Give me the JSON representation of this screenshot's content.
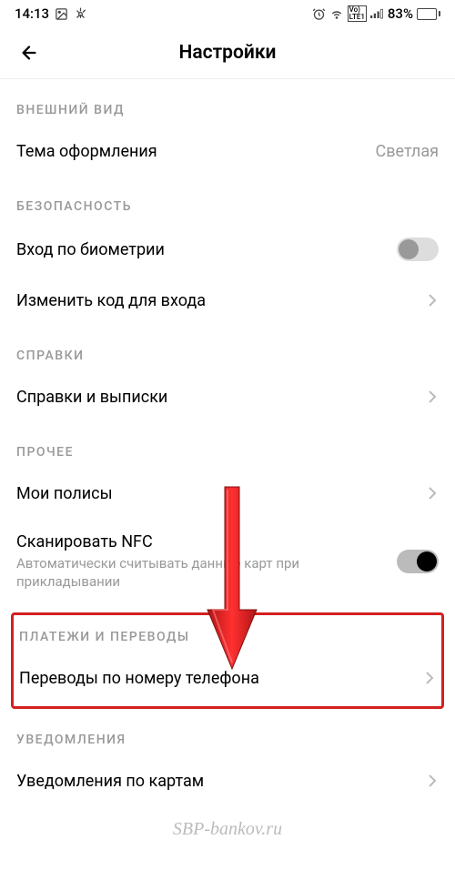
{
  "statusBar": {
    "time": "14:13",
    "battery": "83%"
  },
  "header": {
    "title": "Настройки"
  },
  "sections": {
    "appearance": {
      "header": "ВНЕШНИЙ ВИД",
      "theme": {
        "label": "Тема оформления",
        "value": "Светлая"
      }
    },
    "security": {
      "header": "БЕЗОПАСНОСТЬ",
      "biometric": {
        "label": "Вход по биометрии",
        "enabled": false
      },
      "changeCode": {
        "label": "Изменить код для входа"
      }
    },
    "references": {
      "header": "СПРАВКИ",
      "statements": {
        "label": "Справки и выписки"
      }
    },
    "other": {
      "header": "ПРОЧЕЕ",
      "policies": {
        "label": "Мои полисы"
      },
      "nfc": {
        "label": "Сканировать NFC",
        "sublabel": "Автоматически считывать данные карт при прикладывании",
        "enabled": true
      }
    },
    "payments": {
      "header": "ПЛАТЕЖИ И ПЕРЕВОДЫ",
      "phoneTransfers": {
        "label": "Переводы по номеру телефона"
      }
    },
    "notifications": {
      "header": "УВЕДОМЛЕНИЯ",
      "cards": {
        "label": "Уведомления по картам"
      }
    }
  },
  "watermark": "SBP-bankov.ru"
}
